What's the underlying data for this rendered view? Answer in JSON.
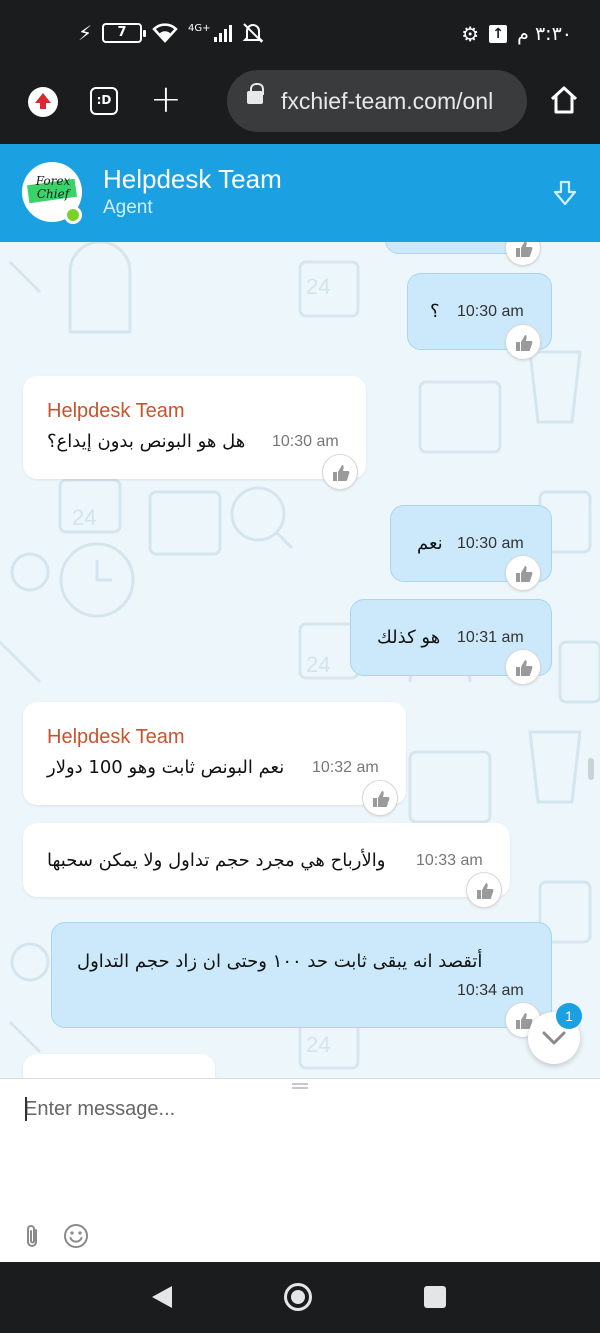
{
  "status_bar": {
    "battery_level": "7",
    "network_type": "4G+",
    "time": "٣:٣٠ م",
    "icons": [
      "charging-icon",
      "battery-icon",
      "wifi-icon",
      "signal-icon",
      "mute-icon",
      "settings-icon",
      "upload-icon"
    ]
  },
  "browser": {
    "url": "fxchief-team.com/onl",
    "tab_switcher_label": ":D",
    "icons": [
      "update-icon",
      "tabs-icon",
      "new-tab-icon",
      "lock-icon",
      "home-icon"
    ]
  },
  "chat_header": {
    "agent_name": "Helpdesk Team",
    "agent_role": "Agent",
    "avatar_logo_text": "Forex Chief",
    "online": true
  },
  "messages": [
    {
      "direction": "out",
      "text": "؟",
      "time": "10:30 am"
    },
    {
      "direction": "in",
      "sender": "Helpdesk Team",
      "text": "هل هو البونص بدون إيداع؟",
      "time": "10:30 am"
    },
    {
      "direction": "out",
      "text": "نعم",
      "time": "10:30 am"
    },
    {
      "direction": "out",
      "text": "هو كذلك",
      "time": "10:31 am"
    },
    {
      "direction": "in",
      "sender": "Helpdesk Team",
      "text": "نعم البونص ثابت وهو 100 دولار",
      "time": "10:32 am"
    },
    {
      "direction": "in",
      "text": "والأرباح هي مجرد حجم تداول ولا يمكن سحبها",
      "time": "10:33 am"
    },
    {
      "direction": "out",
      "text": "أتقصد انه يبقى ثابت حد ١٠٠ وحتى ان زاد حجم التداول",
      "time": "10:34 am"
    }
  ],
  "unread_badge": "1",
  "composer": {
    "placeholder": "Enter message...",
    "value": ""
  },
  "colors": {
    "header": "#1ba1e2",
    "outgoing_bubble": "#cbe9fb",
    "incoming_bubble": "#ffffff",
    "sender_name": "#c8532c",
    "chat_background": "#edf6fa"
  }
}
